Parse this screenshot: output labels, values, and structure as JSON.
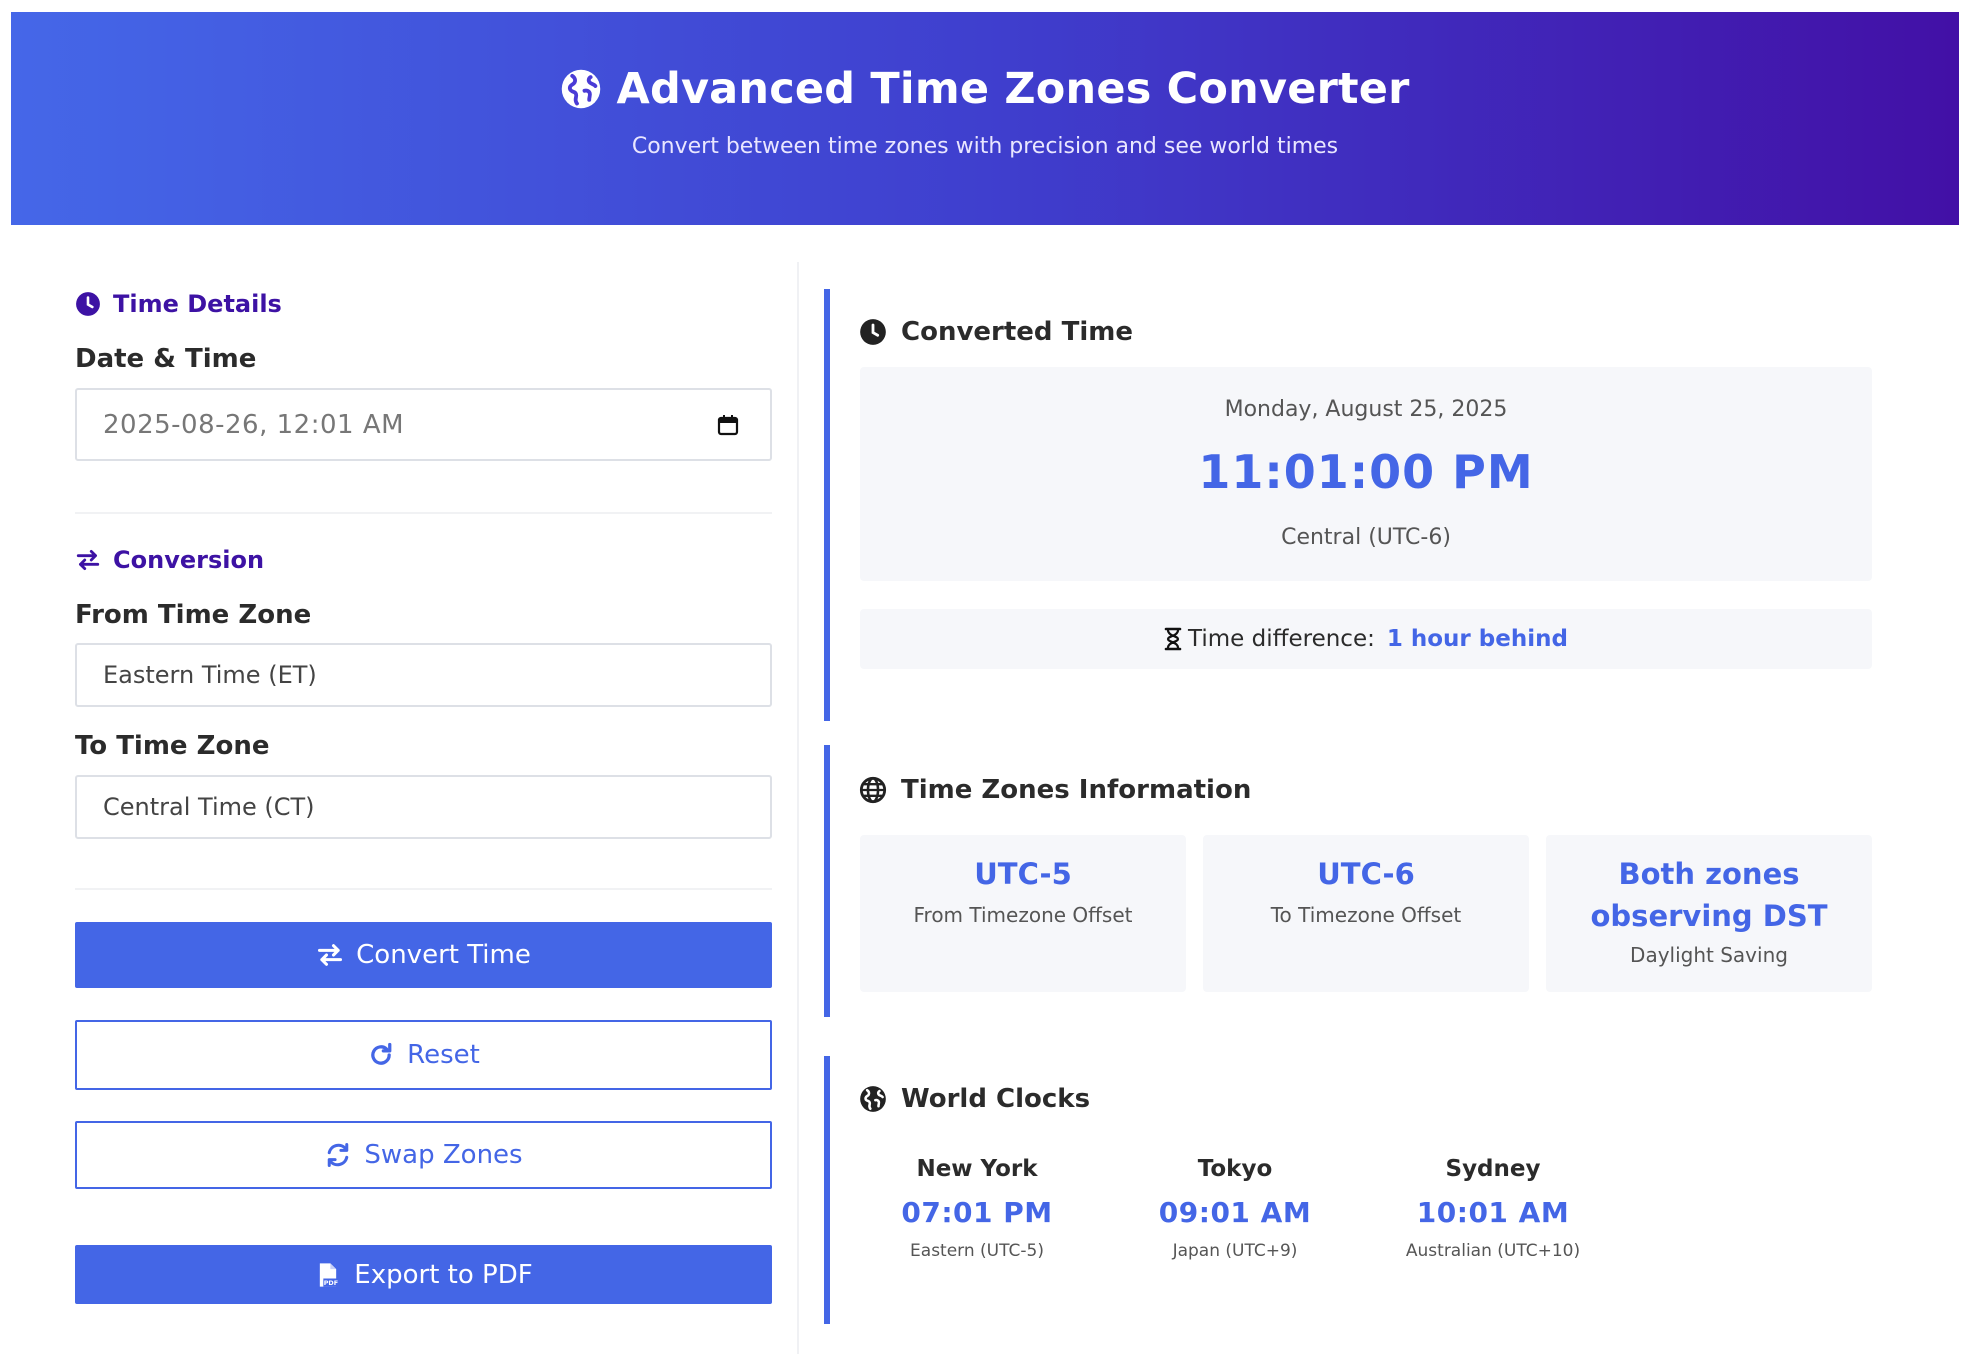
{
  "header": {
    "title": "Advanced Time Zones Converter",
    "subtitle": "Convert between time zones with precision and see world times",
    "icon": "globe-icon"
  },
  "colors": {
    "accent": "#4466e6",
    "heading_purple": "#3d12a4",
    "header_gradient": [
      "#4567e8",
      "#4210a6"
    ]
  },
  "left": {
    "time_details": {
      "title": "Time Details",
      "date_label": "Date & Time",
      "date_value": "2025-08-26, 12:01 AM"
    },
    "conversion": {
      "title": "Conversion",
      "from_label": "From Time Zone",
      "from_value": "Eastern Time (ET)",
      "to_label": "To Time Zone",
      "to_value": "Central Time (CT)"
    },
    "buttons": {
      "convert": "Convert Time",
      "reset": "Reset",
      "swap": "Swap Zones",
      "export": "Export to PDF"
    }
  },
  "converted": {
    "title": "Converted Time",
    "date": "Monday, August 25, 2025",
    "time": "11:01:00 PM",
    "zone": "Central (UTC-6)",
    "diff_label": "Time difference:",
    "diff_value": "1 hour behind"
  },
  "tz_info": {
    "title": "Time Zones Information",
    "boxes": [
      {
        "value": "UTC-5",
        "label": "From Timezone Offset"
      },
      {
        "value": "UTC-6",
        "label": "To Timezone Offset"
      },
      {
        "value_line1": "Both zones",
        "value_line2": "observing DST",
        "label": "Daylight Saving"
      }
    ]
  },
  "world_clocks": {
    "title": "World Clocks",
    "clocks": [
      {
        "city": "New York",
        "time": "07:01 PM",
        "zone": "Eastern (UTC-5)"
      },
      {
        "city": "Tokyo",
        "time": "09:01 AM",
        "zone": "Japan (UTC+9)"
      },
      {
        "city": "Sydney",
        "time": "10:01 AM",
        "zone": "Australian (UTC+10)"
      }
    ]
  }
}
